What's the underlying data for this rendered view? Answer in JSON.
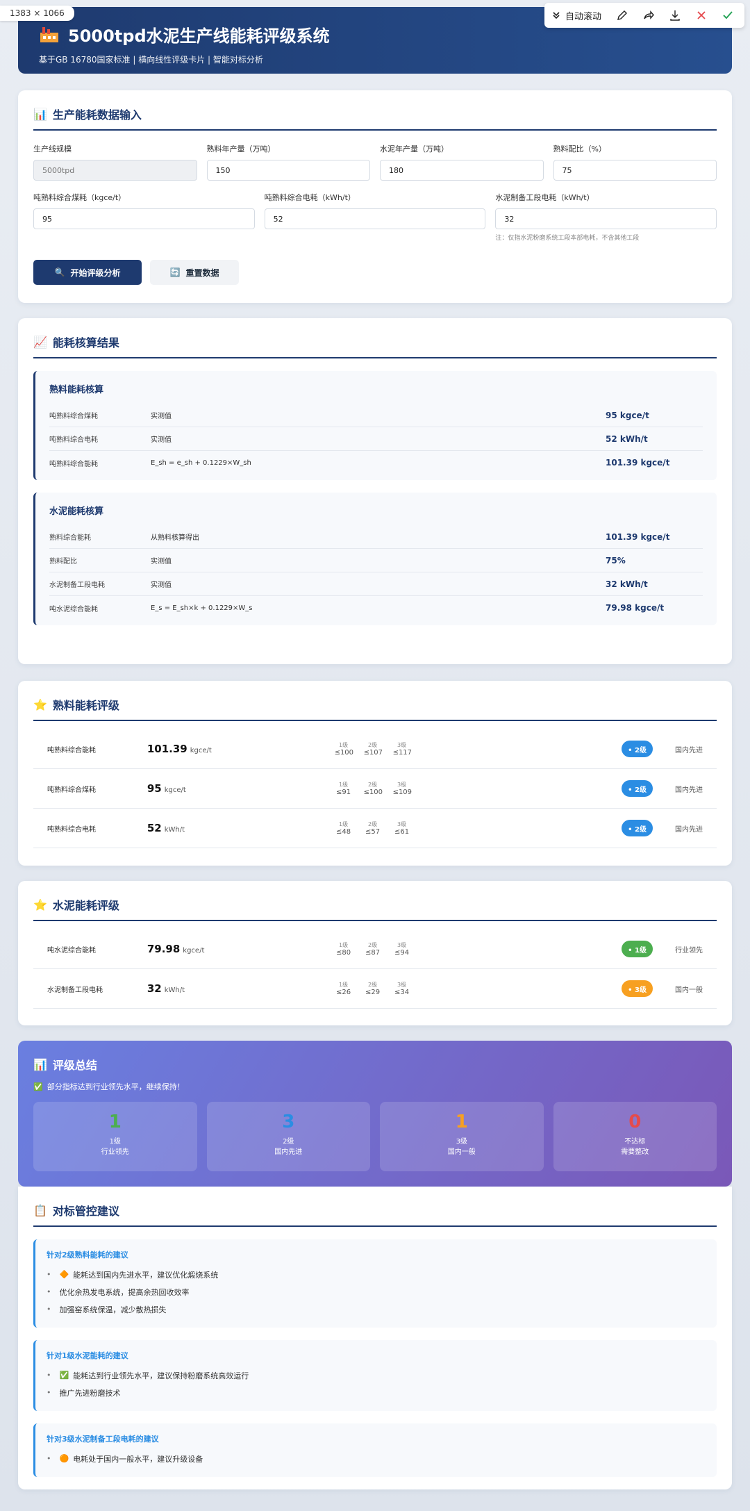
{
  "overlay": {
    "size_tag": "1383 × 1066"
  },
  "toolbar": {
    "auto_scroll": "自动滚动"
  },
  "header": {
    "title": "5000tpd水泥生产线能耗评级系统",
    "subtitle": "基于GB 16780国家标准 | 横向线性评级卡片 | 智能对标分析"
  },
  "input": {
    "title": "生产能耗数据输入",
    "fields_row1": [
      {
        "label": "生产线规模",
        "value": "5000tpd",
        "disabled": true
      },
      {
        "label": "熟料年产量（万吨）",
        "value": "150"
      },
      {
        "label": "水泥年产量（万吨）",
        "value": "180"
      },
      {
        "label": "熟料配比（%）",
        "value": "75"
      }
    ],
    "fields_row2": [
      {
        "label": "吨熟料综合煤耗（kgce/t）",
        "value": "95"
      },
      {
        "label": "吨熟料综合电耗（kWh/t）",
        "value": "52"
      },
      {
        "label": "水泥制备工段电耗（kWh/t）",
        "value": "32",
        "note": "注：仅指水泥粉磨系统工段本部电耗，不含其他工段"
      }
    ],
    "start_button": "开始评级分析",
    "reset_button": "重置数据"
  },
  "calc": {
    "title": "能耗核算结果",
    "clinker": {
      "title": "熟料能耗核算",
      "rows": [
        {
          "name": "吨熟料综合煤耗",
          "method": "实测值",
          "value": "95 kgce/t"
        },
        {
          "name": "吨熟料综合电耗",
          "method": "实测值",
          "value": "52 kWh/t"
        },
        {
          "name": "吨熟料综合能耗",
          "method": "E_sh = e_sh + 0.1229×W_sh",
          "value": "101.39 kgce/t"
        }
      ]
    },
    "cement": {
      "title": "水泥能耗核算",
      "rows": [
        {
          "name": "熟料综合能耗",
          "method": "从熟料核算得出",
          "value": "101.39 kgce/t"
        },
        {
          "name": "熟料配比",
          "method": "实测值",
          "value": "75%"
        },
        {
          "name": "水泥制备工段电耗",
          "method": "实测值",
          "value": "32 kWh/t"
        },
        {
          "name": "吨水泥综合能耗",
          "method": "E_s = E_sh×k + 0.1229×W_s",
          "value": "79.98 kgce/t"
        }
      ]
    }
  },
  "clinker_rating": {
    "title": "熟料能耗评级",
    "rows": [
      {
        "name": "吨熟料综合能耗",
        "value": "101.39",
        "unit": "kgce/t",
        "levels": [
          {
            "l": "1级",
            "v": "≤100"
          },
          {
            "l": "2级",
            "v": "≤107"
          },
          {
            "l": "3级",
            "v": "≤117"
          }
        ],
        "badge": "• 2级",
        "grade": 2,
        "desc": "国内先进"
      },
      {
        "name": "吨熟料综合煤耗",
        "value": "95",
        "unit": "kgce/t",
        "levels": [
          {
            "l": "1级",
            "v": "≤91"
          },
          {
            "l": "2级",
            "v": "≤100"
          },
          {
            "l": "3级",
            "v": "≤109"
          }
        ],
        "badge": "• 2级",
        "grade": 2,
        "desc": "国内先进"
      },
      {
        "name": "吨熟料综合电耗",
        "value": "52",
        "unit": "kWh/t",
        "levels": [
          {
            "l": "1级",
            "v": "≤48"
          },
          {
            "l": "2级",
            "v": "≤57"
          },
          {
            "l": "3级",
            "v": "≤61"
          }
        ],
        "badge": "• 2级",
        "grade": 2,
        "desc": "国内先进"
      }
    ]
  },
  "cement_rating": {
    "title": "水泥能耗评级",
    "rows": [
      {
        "name": "吨水泥综合能耗",
        "value": "79.98",
        "unit": "kgce/t",
        "levels": [
          {
            "l": "1级",
            "v": "≤80"
          },
          {
            "l": "2级",
            "v": "≤87"
          },
          {
            "l": "3级",
            "v": "≤94"
          }
        ],
        "badge": "• 1级",
        "grade": 1,
        "desc": "行业领先"
      },
      {
        "name": "水泥制备工段电耗",
        "value": "32",
        "unit": "kWh/t",
        "levels": [
          {
            "l": "1级",
            "v": "≤26"
          },
          {
            "l": "2级",
            "v": "≤29"
          },
          {
            "l": "3级",
            "v": "≤34"
          }
        ],
        "badge": "• 3级",
        "grade": 3,
        "desc": "国内一般"
      }
    ]
  },
  "summary": {
    "title": "评级总结",
    "message": "部分指标达到行业领先水平，继续保持！",
    "boxes": [
      {
        "num": "1",
        "line1": "1级",
        "line2": "行业领先",
        "color": "#4cae4f"
      },
      {
        "num": "3",
        "line1": "2级",
        "line2": "国内先进",
        "color": "#2b8de3"
      },
      {
        "num": "1",
        "line1": "3级",
        "line2": "国内一般",
        "color": "#f7a021"
      },
      {
        "num": "0",
        "line1": "不达标",
        "line2": "需要整改",
        "color": "#e54b4b"
      }
    ]
  },
  "advice": {
    "title": "对标管控建议",
    "groups": [
      {
        "title": "针对2级熟料能耗的建议",
        "items": [
          {
            "icon": "diamond",
            "text": "能耗达到国内先进水平，建议优化煅烧系统"
          },
          {
            "icon": "",
            "text": "优化余热发电系统，提高余热回收效率"
          },
          {
            "icon": "",
            "text": "加强窑系统保温，减少散热损失"
          }
        ]
      },
      {
        "title": "针对1级水泥能耗的建议",
        "items": [
          {
            "icon": "check",
            "text": "能耗达到行业领先水平，建议保持粉磨系统高效运行"
          },
          {
            "icon": "",
            "text": "推广先进粉磨技术"
          }
        ]
      },
      {
        "title": "针对3级水泥制备工段电耗的建议",
        "items": [
          {
            "icon": "orange-circle",
            "text": "电耗处于国内一般水平，建议升级设备"
          }
        ]
      }
    ]
  }
}
